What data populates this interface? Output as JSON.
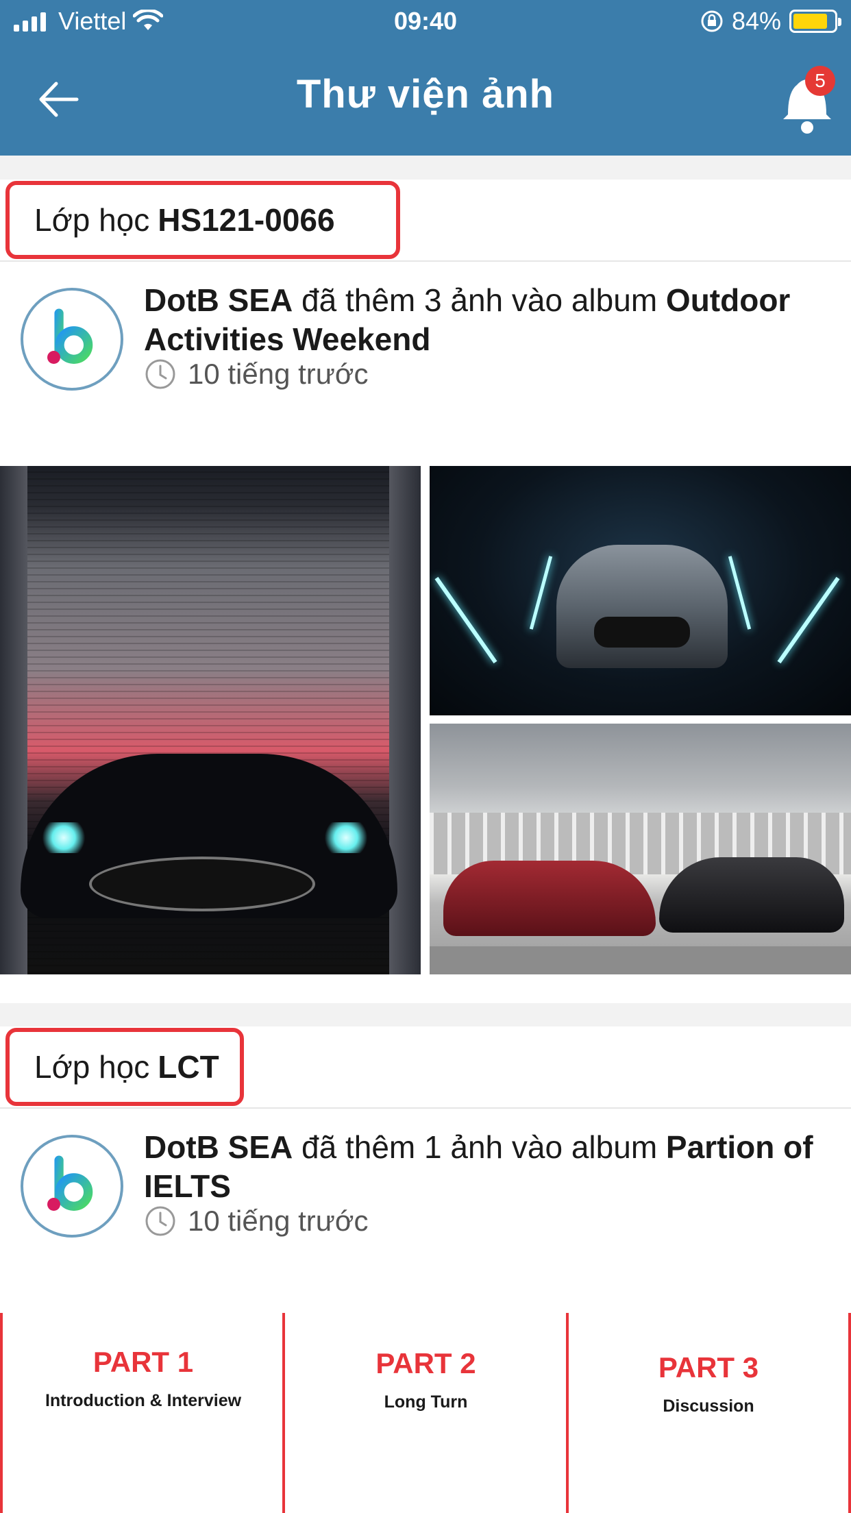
{
  "status_bar": {
    "carrier": "Viettel",
    "time": "09:40",
    "battery": "84%",
    "battery_level": 0.84
  },
  "nav": {
    "title": "Thư viện ảnh",
    "notification_count": "5"
  },
  "sections": [
    {
      "class_prefix": "Lớp học",
      "class_code": "HS121-0066",
      "author": "DotB SEA",
      "action": "đã thêm 3 ảnh vào album",
      "album": "Outdoor Activities Weekend",
      "time_ago": "10 tiếng trước"
    },
    {
      "class_prefix": "Lớp học",
      "class_code": "LCT",
      "author": "DotB SEA",
      "action": "đã thêm 1 ảnh vào album",
      "album": "Partion of IELTS",
      "time_ago": "10 tiếng trước",
      "parts": [
        {
          "title": "PART 1",
          "subtitle": "Introduction & Interview"
        },
        {
          "title": "PART 2",
          "subtitle": "Long Turn"
        },
        {
          "title": "PART 3",
          "subtitle": "Discussion"
        }
      ]
    }
  ],
  "colors": {
    "header": "#3b7dab",
    "highlight": "#e8343a",
    "badge": "#e53935"
  }
}
